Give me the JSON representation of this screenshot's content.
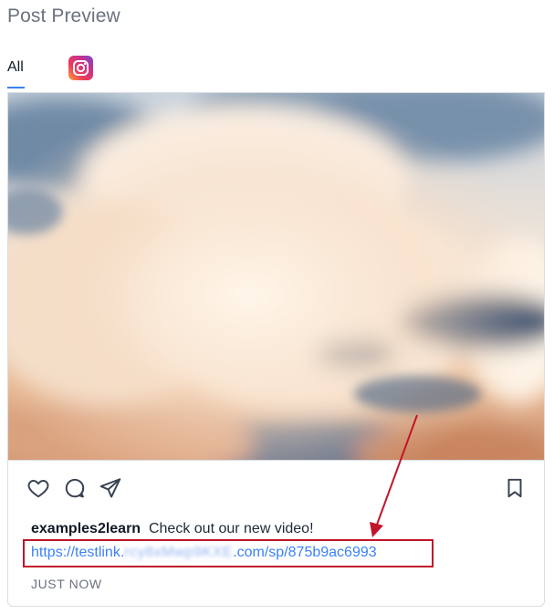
{
  "page": {
    "title": "Post Preview"
  },
  "tabs": [
    {
      "label": "All",
      "active": true
    },
    {
      "icon": "instagram-icon"
    }
  ],
  "post": {
    "username": "examples2learn",
    "caption": "Check out our new video!",
    "link_prefix": "https://testlink.",
    "link_blurred": "rcy8xMwp9KXE",
    "link_suffix": ".com/sp/875b9ac6993",
    "timestamp": "JUST NOW",
    "actions": [
      "heart-icon",
      "comment-icon",
      "share-icon",
      "bookmark-icon"
    ]
  },
  "colors": {
    "accent": "#3b82f6",
    "annotation": "#c0152a",
    "border": "#d9dde3"
  }
}
